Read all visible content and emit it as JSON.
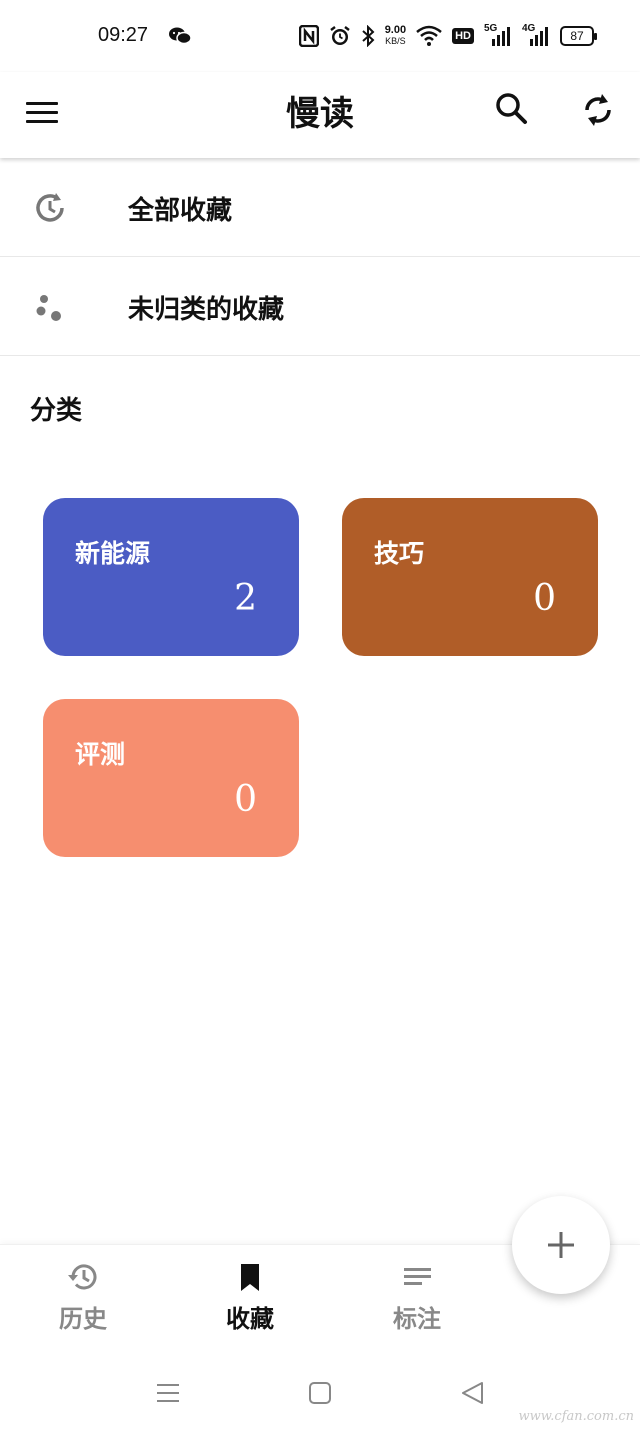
{
  "status_bar": {
    "time": "09:27",
    "net_speed": "9.00",
    "net_unit": "KB/S",
    "hd_badge": "HD",
    "signal_5g": "5G",
    "signal_4g": "4G",
    "battery": "87"
  },
  "app_bar": {
    "title": "慢读",
    "menu_icon": "hamburger-menu-icon",
    "search_icon": "search-icon",
    "sync_icon": "sync-icon"
  },
  "rows": [
    {
      "label": "全部收藏",
      "icon": "history-clock-icon"
    },
    {
      "label": "未归类的收藏",
      "icon": "dots-cluster-icon"
    }
  ],
  "section": {
    "title": "分类"
  },
  "categories": [
    {
      "name": "新能源",
      "count": "2",
      "color": "#4b5cc4"
    },
    {
      "name": "技巧",
      "count": "0",
      "color": "#b05d28"
    },
    {
      "name": "评测",
      "count": "0",
      "color": "#f68e6f"
    }
  ],
  "bottom_nav": [
    {
      "label": "历史",
      "icon": "history-icon",
      "active": false
    },
    {
      "label": "收藏",
      "icon": "bookmark-icon",
      "active": true
    },
    {
      "label": "标注",
      "icon": "notes-lines-icon",
      "active": false
    }
  ],
  "fab": {
    "icon": "plus-icon"
  },
  "system_nav": [
    "recents-icon",
    "home-icon",
    "back-icon"
  ],
  "watermark": "www.cfan.com.cn"
}
